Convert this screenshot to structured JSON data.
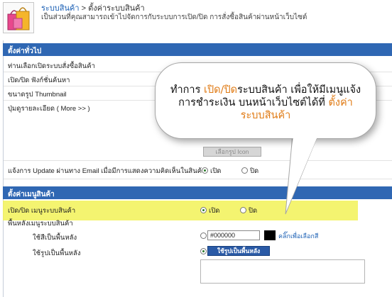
{
  "header": {
    "breadcrumb_link": "ระบบสินค้า",
    "breadcrumb_sep": " > ",
    "breadcrumb_current": "ตั้งค่าระบบสินค้า",
    "subtitle": "เป็นส่วนที่คุณสามารถเข้าไปจัดการกับระบบการเปิด/ปิด การสั่งซื้อสินค้าผ่านหน้าเว็บไซต์"
  },
  "general": {
    "title": "ตั้งค่าทั่วไป",
    "rows": {
      "r1": "ท่านเลือกเปิดระบบสั่งซื้อสินค้า",
      "r2": "เปิด/ปิด ฟังก์ชั่นค้นหา",
      "r3": "ขนาดรูป Thumbnail",
      "r4": "ปุ่มดูรายละเอียด ( More >> )",
      "r5": "แจ้งการ Update ผ่านทาง Email เมื่อมีการแสดงความคิดเห็นในสินค้า"
    },
    "icon_button": "เลือกรูป Icon",
    "open_label": "เปิด",
    "close_label": "ปิด"
  },
  "menu": {
    "title": "ตั้งค่าเมนูสินค้า",
    "row_toggle": "เปิด/ปิด เมนูระบบสินค้า",
    "row_bg": "พื้นหลังเมนูระบบสินค้า",
    "use_color": "ใช้สีเป็นพื้นหลัง",
    "use_image": "ใช้รูปเป็นพื้นหลัง",
    "color_value": "#000000",
    "pick_color": "คลิ๊กเพื่อเลือกสี",
    "image_button": "ใช้รูปเป็นพื้นหลัง",
    "open_label": "เปิด",
    "close_label": "ปิด"
  },
  "callout": {
    "line1a": "ทำการ ",
    "line1b": "เปิด/ปิด",
    "line1c": "ระบบสินค้า เพื่อให้มีเมนูแจ้ง",
    "line2a": "การชำระเงิน บนหน้าเว็บไซต์ได้ที่ ",
    "line2b": "ตั้งค่า",
    "line3": "ระบบสินค้า"
  },
  "colors": {
    "section_header": "#2f67b3",
    "highlight": "#f2f257",
    "accent_text": "#e07b15"
  }
}
